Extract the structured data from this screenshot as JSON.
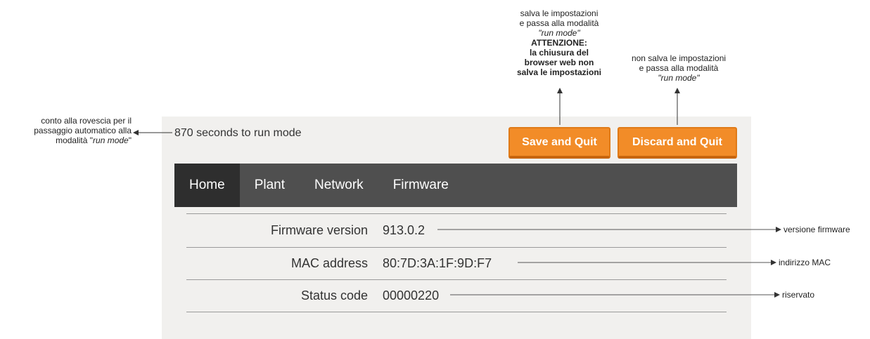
{
  "countdown_text": "870 seconds to run mode",
  "buttons": {
    "save": "Save and Quit",
    "discard": "Discard and Quit"
  },
  "nav": {
    "home": "Home",
    "plant": "Plant",
    "network": "Network",
    "firmware": "Firmware"
  },
  "info": {
    "firmware_label": "Firmware version",
    "firmware_value": "913.0.2",
    "mac_label": "MAC address",
    "mac_value": "80:7D:3A:1F:9D:F7",
    "status_label": "Status code",
    "status_value": "00000220"
  },
  "annotations": {
    "countdown": {
      "line1": "conto alla rovescia per il",
      "line2": "passaggio automatico alla",
      "line3_prefix": "modalità \"",
      "line3_em": "run mode",
      "line3_suffix": "\""
    },
    "save": {
      "line1": "salva le impostazioni",
      "line2": "e passa alla modalità",
      "line3": "\"run mode\"",
      "bold1": "ATTENZIONE:",
      "bold2": "la chiusura del",
      "bold3": "browser web non",
      "bold4": "salva le impostazioni"
    },
    "discard": {
      "line1": "non salva le impostazioni",
      "line2": "e passa alla modalità",
      "line3": "\"run mode\""
    },
    "firmware": "versione firmware",
    "mac": "indirizzo MAC",
    "status": "riservato"
  },
  "colors": {
    "accent_button": "#f28c28",
    "navbar": "#4f4f4f",
    "navbar_active": "#2e2e2e",
    "panel": "#f1f0ee"
  }
}
